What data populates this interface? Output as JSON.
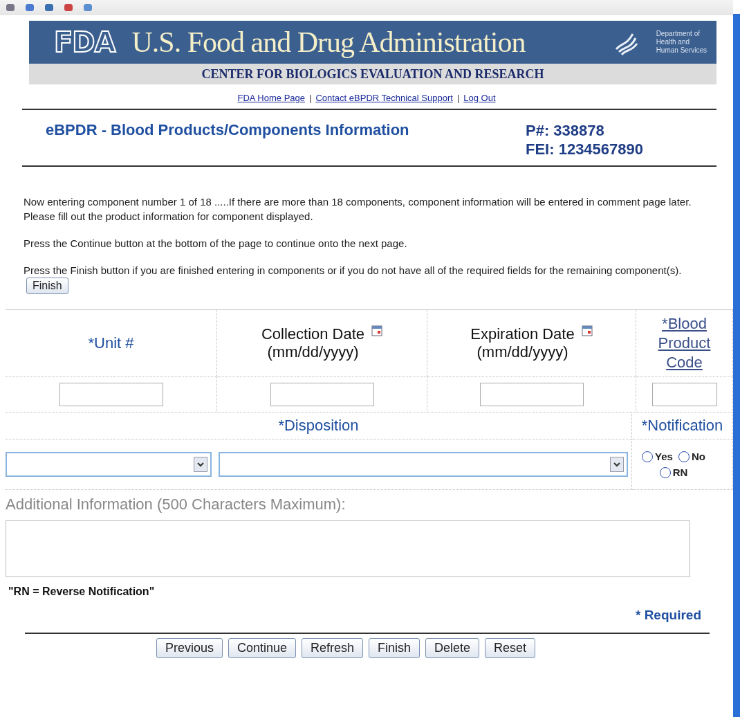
{
  "header": {
    "logo": "FDA",
    "title": "U.S. Food and Drug Administration",
    "department": [
      "Department of",
      "Health and",
      "Human Services"
    ],
    "center": "CENTER FOR BIOLOGICS EVALUATION AND RESEARCH"
  },
  "nav": [
    {
      "kind": "link",
      "text": "FDA Home Page"
    },
    {
      "kind": "separator",
      "text": "|"
    },
    {
      "kind": "link",
      "text": "Contact eBPDR Technical Support"
    },
    {
      "kind": "separator",
      "text": "|"
    },
    {
      "kind": "link",
      "text": "Log Out"
    }
  ],
  "page_title": "eBPDR - Blood Products/Components Information",
  "ids": [
    "P#: 338878",
    "FEI: 1234567890"
  ],
  "instructions": [
    "Now entering component number 1 of 18 .....If there are more than 18 components, component information will be entered in comment page later. Please fill out the product information for component displayed.",
    "Press the Continue button at the bottom of the page to continue onto the next page.",
    "Press the Finish button if you are finished entering in components or if you do not have all of the required fields for the remaining component(s)."
  ],
  "inline_button": "Finish",
  "columns": [
    {
      "kind": "required",
      "label": "*Unit #"
    },
    {
      "kind": "date",
      "label": "Collection Date",
      "hint": "(mm/dd/yyyy)"
    },
    {
      "kind": "date",
      "label": "Expiration Date",
      "hint": "(mm/dd/yyyy)"
    },
    {
      "kind": "link",
      "label": "*Blood Product Code"
    }
  ],
  "disposition_label": "*Disposition",
  "notification_label": "*Notification",
  "notification_options": [
    {
      "label": "Yes",
      "selected": false
    },
    {
      "label": "No",
      "selected": false
    },
    {
      "label": "RN",
      "selected": false
    }
  ],
  "additional_label": "Additional Information (500 Characters Maximum):",
  "note": "\"RN = Reverse Notification\"",
  "required": "* Required",
  "buttons": [
    "Previous",
    "Continue",
    "Refresh",
    "Finish",
    "Delete",
    "Reset"
  ]
}
